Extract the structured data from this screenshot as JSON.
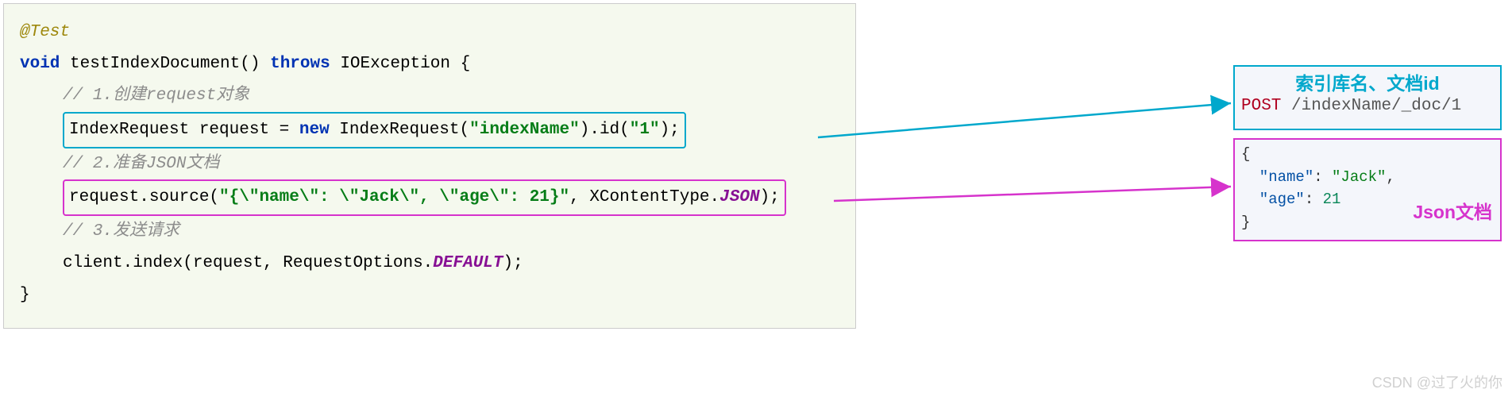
{
  "code": {
    "annotation": "@Test",
    "line_void": "void",
    "method": "testIndexDocument()",
    "throws": "throws",
    "exception": "IOException",
    "brace_open": "{",
    "brace_close": "}",
    "comment1": "// 1.创建request对象",
    "comment2": "// 2.准备JSON文档",
    "comment3": "// 3.发送请求",
    "line_request_1a": "IndexRequest request = ",
    "line_request_new": "new",
    "line_request_1b": " IndexRequest(",
    "str_indexName": "\"indexName\"",
    "line_request_1c": ").id(",
    "str_id": "\"1\"",
    "line_request_1d": ");",
    "line_source_a": "request.source(",
    "str_json": "\"{\\\"name\\\": \\\"Jack\\\", \\\"age\\\": 21}\"",
    "line_source_b": ", XContentType.",
    "json_const": "JSON",
    "line_source_c": ");",
    "line_client_a": "client.index(request, RequestOptions.",
    "default_const": "DEFAULT",
    "line_client_b": ");"
  },
  "callout_blue": {
    "title": "索引库名、文档id",
    "method": "POST",
    "path": " /indexName/_doc/1"
  },
  "callout_pink": {
    "title": "Json文档",
    "l1": "{",
    "l2a": "  \"name\"",
    "l2b": ": ",
    "l2c": "\"Jack\"",
    "l2d": ",",
    "l3a": "  \"age\"",
    "l3b": ": ",
    "l3c": "21",
    "l4": "}"
  },
  "watermark": "CSDN @过了火的你"
}
